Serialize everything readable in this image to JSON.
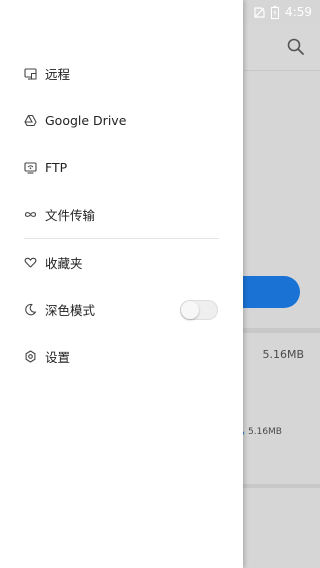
{
  "status_bar": {
    "time": "4:59"
  },
  "drawer": {
    "items": [
      {
        "label": "远程",
        "icon": "remote-device-icon"
      },
      {
        "label": "Google Drive",
        "icon": "google-drive-icon"
      },
      {
        "label": "FTP",
        "icon": "ftp-icon"
      },
      {
        "label": "文件传输",
        "icon": "infinity-transfer-icon"
      },
      {
        "label": "收藏夹",
        "icon": "heart-icon"
      },
      {
        "label": "深色模式",
        "icon": "moon-icon",
        "toggle_on": false
      },
      {
        "label": "设置",
        "icon": "gear-icon"
      }
    ]
  },
  "background": {
    "file_size_1": "5.16MB",
    "file_size_2": "5.16MB",
    "accent_color": "#1a73d4"
  }
}
